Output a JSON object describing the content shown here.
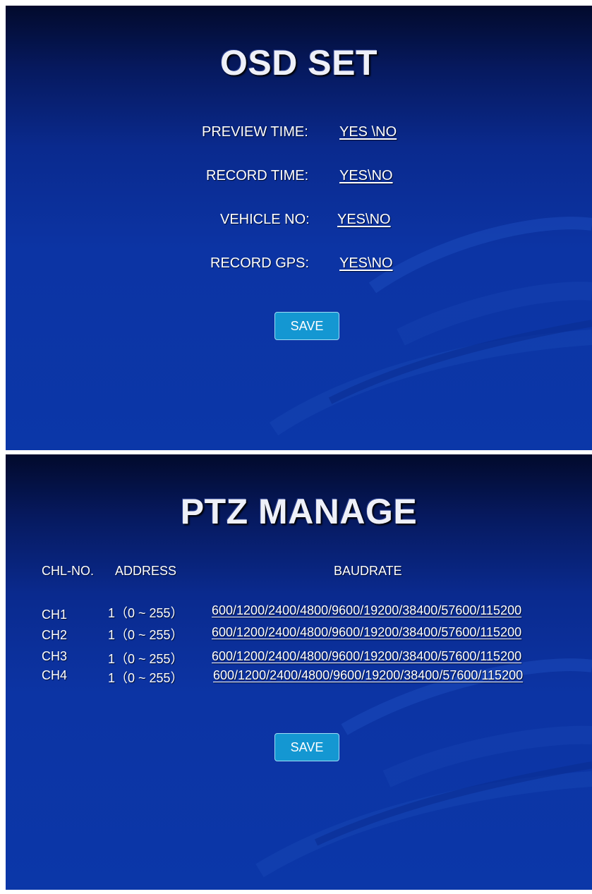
{
  "osd": {
    "title": "OSD SET",
    "rows": [
      {
        "label": "PREVIEW TIME:",
        "value": "YES \\NO"
      },
      {
        "label": "RECORD TIME:",
        "value": "YES\\NO"
      },
      {
        "label": "VEHICLE NO:",
        "value": "YES\\NO"
      },
      {
        "label": "RECORD GPS:",
        "value": "YES\\NO"
      }
    ],
    "save_label": "SAVE"
  },
  "ptz": {
    "title": "PTZ MANAGE",
    "headers": {
      "chl": "CHL-NO.",
      "address": "ADDRESS",
      "baudrate": "BAUDRATE"
    },
    "rows": [
      {
        "ch": "CH1",
        "address": "1（0 ~ 255）",
        "baudrate": "600/1200/2400/4800/9600/19200/38400/57600/115200"
      },
      {
        "ch": "CH2",
        "address": "1（0 ~ 255）",
        "baudrate": "600/1200/2400/4800/9600/19200/38400/57600/115200"
      },
      {
        "ch": "CH3",
        "address": "1（0 ~ 255）",
        "baudrate": "600/1200/2400/4800/9600/19200/38400/57600/115200"
      },
      {
        "ch": "CH4",
        "address": "1（0 ~ 255）",
        "baudrate": "600/1200/2400/4800/9600/19200/38400/57600/115200"
      }
    ],
    "save_label": "SAVE"
  },
  "colors": {
    "background_top": "#020a2c",
    "background_main": "#0b37a8",
    "button": "#1497d2",
    "text": "#ffffff"
  }
}
